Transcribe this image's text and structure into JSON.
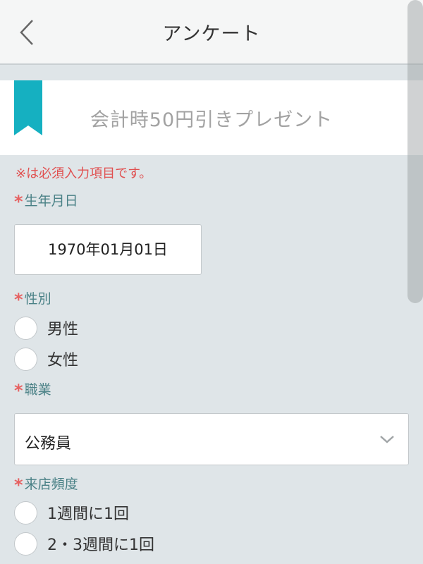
{
  "header": {
    "title": "アンケート",
    "back_icon": "chevron-left-icon"
  },
  "banner": {
    "text": "会計時50円引きプレゼント",
    "ribbon_color": "#15b0c1",
    "ribbon_icon": "bookmark-ribbon-icon"
  },
  "required_note": "※は必須入力項目です。",
  "required_mark": "*",
  "colors": {
    "required": "#e05050",
    "label": "#4a8186",
    "background": "#dfe5e8"
  },
  "fields": {
    "birthdate": {
      "label": "生年月日",
      "value": "1970年01月01日"
    },
    "gender": {
      "label": "性別",
      "options": [
        "男性",
        "女性"
      ]
    },
    "occupation": {
      "label": "職業",
      "selected": "公務員"
    },
    "visit_frequency": {
      "label": "来店頻度",
      "options": [
        "1週間に1回",
        "2・3週間に1回"
      ]
    }
  }
}
